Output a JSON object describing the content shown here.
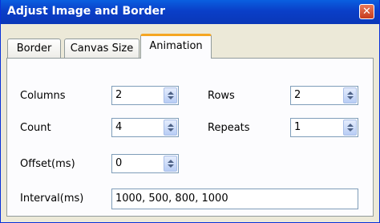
{
  "window": {
    "title": "Adjust Image and Border",
    "close_symbol": "✕"
  },
  "tabs": [
    {
      "label": "Border"
    },
    {
      "label": "Canvas Size"
    },
    {
      "label": "Animation"
    }
  ],
  "active_tab": "Animation",
  "fields": {
    "columns": {
      "label": "Columns",
      "value": "2"
    },
    "rows": {
      "label": "Rows",
      "value": "2"
    },
    "count": {
      "label": "Count",
      "value": "4"
    },
    "repeats": {
      "label": "Repeats",
      "value": "1"
    },
    "offset": {
      "label": "Offset(ms)",
      "value": "0"
    },
    "interval": {
      "label": "Interval(ms)",
      "value": "1000, 500, 800, 1000"
    }
  },
  "colors": {
    "titlebar": "#0a3fc8",
    "close_button": "#c63b1c",
    "active_tab_accent": "#f5a623"
  }
}
